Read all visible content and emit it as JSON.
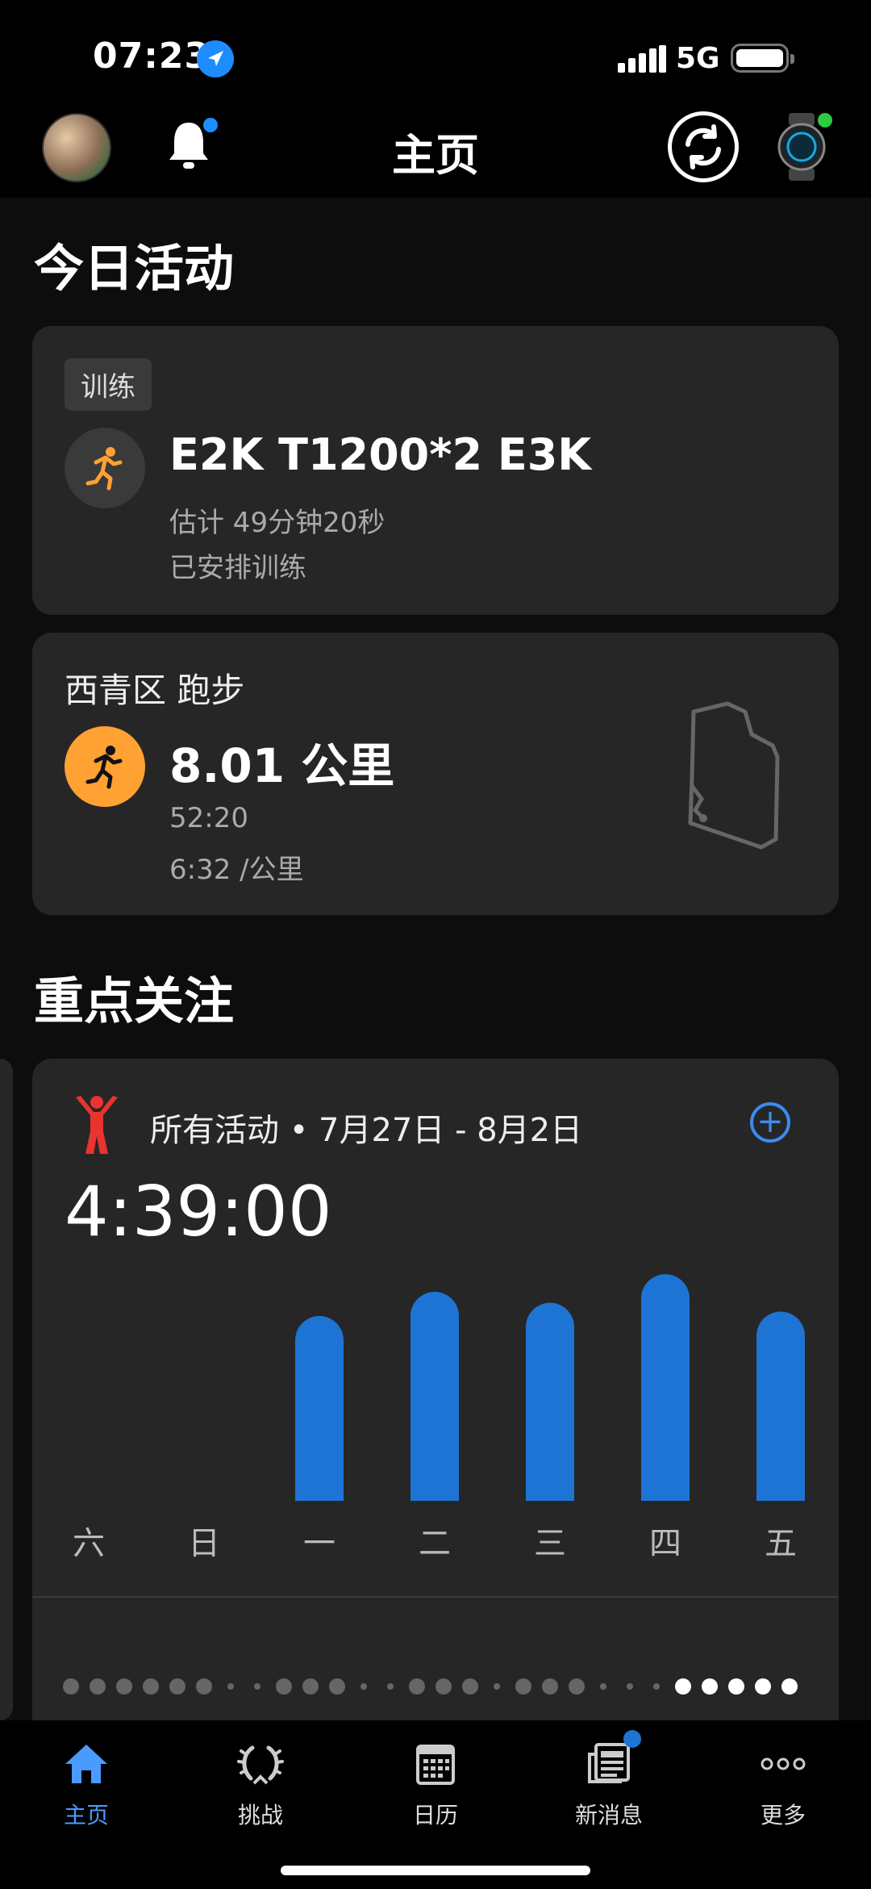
{
  "status_bar": {
    "time": "07:23",
    "network": "5G"
  },
  "header": {
    "title": "主页"
  },
  "today": {
    "section_title": "今日活动",
    "workout": {
      "tag": "训练",
      "title": "E2K T1200*2 E3K",
      "estimate": "估计 49分钟20秒",
      "status": "已安排训练"
    },
    "run": {
      "title": "西青区 跑步",
      "distance": "8.01 公里",
      "duration": "52:20",
      "pace": "6:32 /公里"
    }
  },
  "focus": {
    "section_title": "重点关注",
    "card": {
      "label": "所有活动 • 7月27日 - 8月2日",
      "total_time": "4:39:00"
    }
  },
  "chart_data": {
    "type": "bar",
    "categories": [
      "六",
      "日",
      "一",
      "二",
      "三",
      "四",
      "五"
    ],
    "values": [
      0,
      0,
      0.84,
      0.95,
      0.9,
      1.03,
      0.86
    ],
    "ylim": [
      0,
      1.1
    ],
    "grid": false,
    "color": "#1e74d4"
  },
  "tabs": [
    {
      "label": "主页",
      "active": true
    },
    {
      "label": "挑战",
      "active": false
    },
    {
      "label": "日历",
      "active": false
    },
    {
      "label": "新消息",
      "active": false,
      "badge": true
    },
    {
      "label": "更多",
      "active": false
    }
  ],
  "colors": {
    "accent": "#4a9bff",
    "orange": "#ffa133",
    "bar": "#1e74d4",
    "card": "#262626"
  }
}
